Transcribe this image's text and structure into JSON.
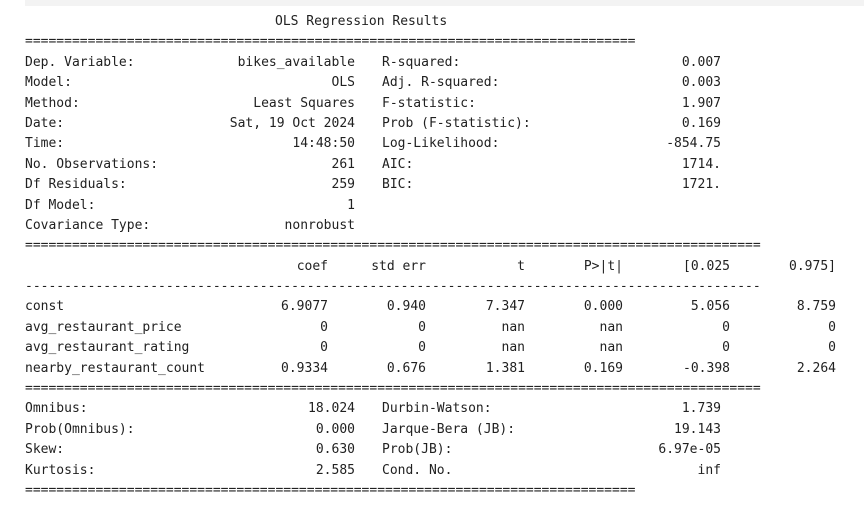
{
  "title": "OLS Regression Results",
  "rule_eq": "==============================================================================",
  "rule_eq_long": "==============================================================================================",
  "rule_dash_long": "----------------------------------------------------------------------------------------------",
  "summary_rows": [
    {
      "left_label": "Dep. Variable:",
      "left_value": "bikes_available",
      "right_label": "R-squared:",
      "right_value": "0.007"
    },
    {
      "left_label": "Model:",
      "left_value": "OLS",
      "right_label": "Adj. R-squared:",
      "right_value": "0.003"
    },
    {
      "left_label": "Method:",
      "left_value": "Least Squares",
      "right_label": "F-statistic:",
      "right_value": "1.907"
    },
    {
      "left_label": "Date:",
      "left_value": "Sat, 19 Oct 2024",
      "right_label": "Prob (F-statistic):",
      "right_value": "0.169"
    },
    {
      "left_label": "Time:",
      "left_value": "14:48:50",
      "right_label": "Log-Likelihood:",
      "right_value": "-854.75"
    },
    {
      "left_label": "No. Observations:",
      "left_value": "261",
      "right_label": "AIC:",
      "right_value": "1714."
    },
    {
      "left_label": "Df Residuals:",
      "left_value": "259",
      "right_label": "BIC:",
      "right_value": "1721."
    },
    {
      "left_label": "Df Model:",
      "left_value": "1",
      "right_label": "",
      "right_value": ""
    },
    {
      "left_label": "Covariance Type:",
      "left_value": "nonrobust",
      "right_label": "",
      "right_value": ""
    }
  ],
  "coef_headers": [
    "coef",
    "std err",
    "t",
    "P>|t|",
    "[0.025",
    "0.975]"
  ],
  "coef_rows": [
    {
      "name": "const",
      "values": [
        "6.9077",
        "0.940",
        "7.347",
        "0.000",
        "5.056",
        "8.759"
      ]
    },
    {
      "name": "avg_restaurant_price",
      "values": [
        "0",
        "0",
        "nan",
        "nan",
        "0",
        "0"
      ]
    },
    {
      "name": "avg_restaurant_rating",
      "values": [
        "0",
        "0",
        "nan",
        "nan",
        "0",
        "0"
      ]
    },
    {
      "name": "nearby_restaurant_count",
      "values": [
        "0.9334",
        "0.676",
        "1.381",
        "0.169",
        "-0.398",
        "2.264"
      ]
    }
  ],
  "diag_rows": [
    {
      "left_label": "Omnibus:",
      "left_value": "18.024",
      "right_label": "Durbin-Watson:",
      "right_value": "1.739"
    },
    {
      "left_label": "Prob(Omnibus):",
      "left_value": "0.000",
      "right_label": "Jarque-Bera (JB):",
      "right_value": "19.143"
    },
    {
      "left_label": "Skew:",
      "left_value": "0.630",
      "right_label": "Prob(JB):",
      "right_value": "6.97e-05"
    },
    {
      "left_label": "Kurtosis:",
      "left_value": "2.585",
      "right_label": "Cond. No.",
      "right_value": "inf"
    }
  ]
}
